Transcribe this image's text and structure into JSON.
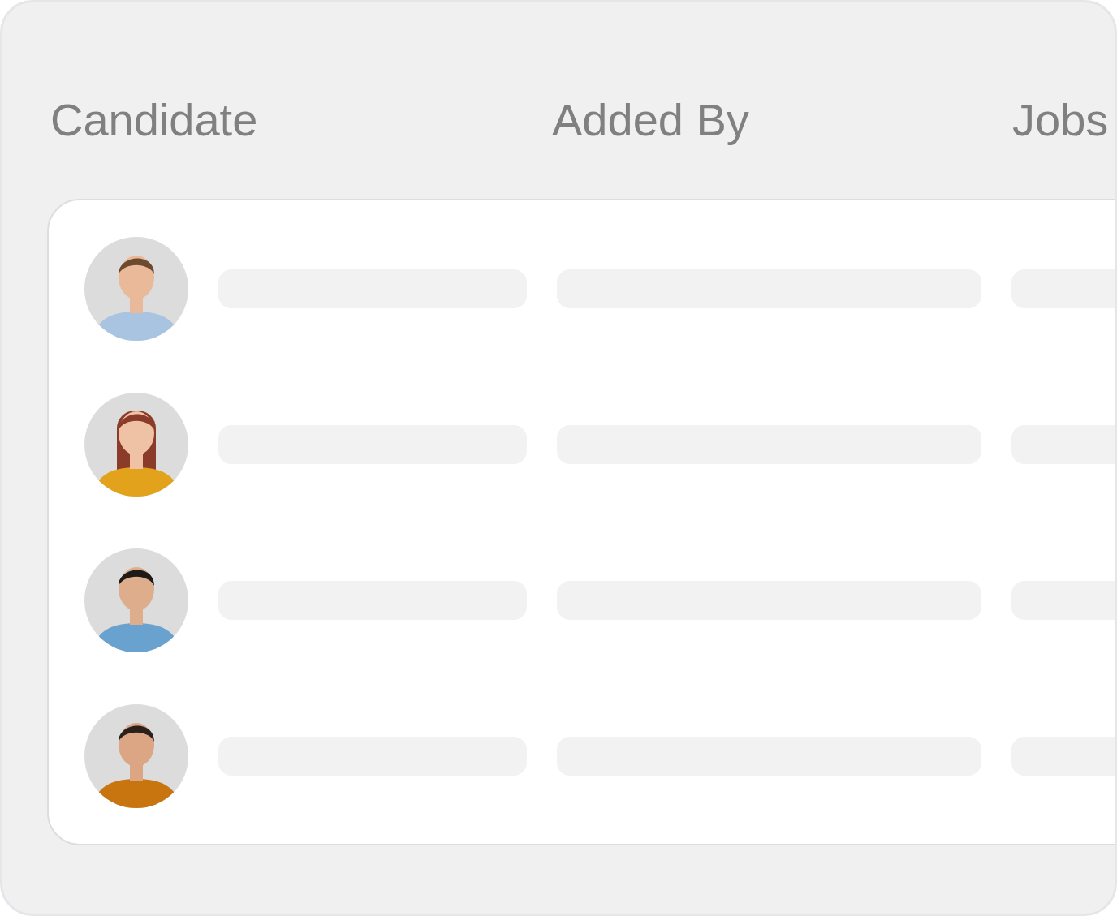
{
  "table": {
    "columns": [
      {
        "label": "Candidate"
      },
      {
        "label": "Added By"
      },
      {
        "label": "Jobs"
      }
    ]
  }
}
